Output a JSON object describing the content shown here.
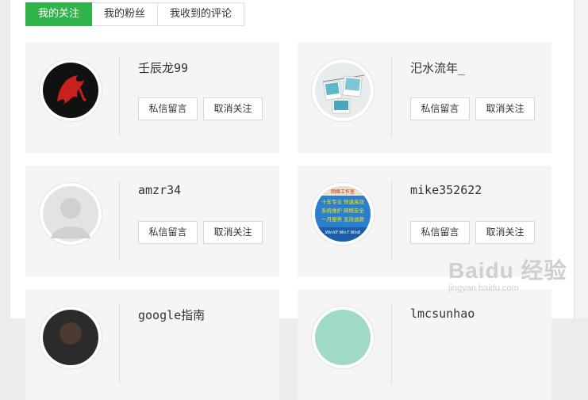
{
  "tabs": [
    {
      "label": "我的关注",
      "active": true
    },
    {
      "label": "我的粉丝",
      "active": false
    },
    {
      "label": "我收到的评论",
      "active": false
    }
  ],
  "follows": [
    {
      "name": "壬辰龙99",
      "avatar": "dragon-logo-avatar",
      "msg_label": "私信留言",
      "unfollow_label": "取消关注"
    },
    {
      "name": "汜水流年_",
      "avatar": "polaroid-photos-avatar",
      "msg_label": "私信留言",
      "unfollow_label": "取消关注"
    },
    {
      "name": "amzr34",
      "avatar": "default-user-avatar",
      "msg_label": "私信留言",
      "unfollow_label": "取消关注"
    },
    {
      "name": "mike352622",
      "avatar": "colorful-text-avatar",
      "msg_label": "私信留言",
      "unfollow_label": "取消关注"
    },
    {
      "name": "google指南",
      "avatar": "dark-avatar"
    },
    {
      "name": "lmcsunhao",
      "avatar": "teal-avatar"
    }
  ],
  "avatar4_text": {
    "line1": "网络工作室",
    "line2": "十年专业 快速高效",
    "line3": "系统维护 网络安全",
    "line4": "一月服务 无效退款",
    "line5": "WinXP Win7 Win8"
  },
  "watermark": {
    "logo": "Baidu 经验",
    "sub": "jingyan.baidu.com"
  },
  "colors": {
    "accent": "#2fb44a",
    "card_bg": "#f5f5f5",
    "dragon_red": "#c8201c"
  }
}
